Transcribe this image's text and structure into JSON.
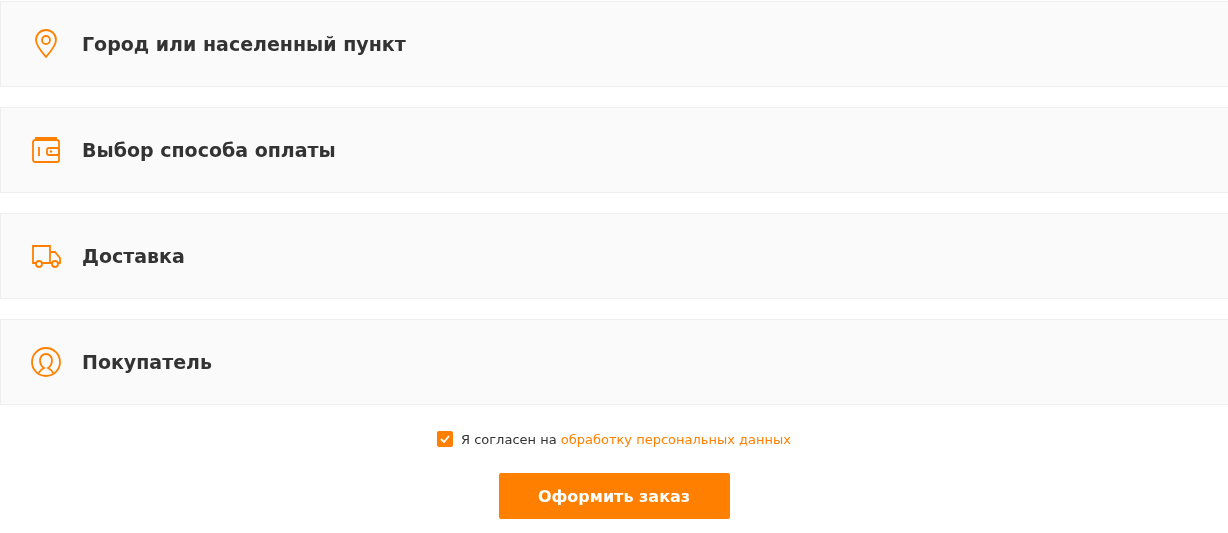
{
  "sections": [
    {
      "kind": "location",
      "title": "Город или населенный пункт"
    },
    {
      "kind": "payment",
      "title": "Выбор способа оплаты"
    },
    {
      "kind": "delivery",
      "title": "Доставка"
    },
    {
      "kind": "buyer",
      "title": "Покупатель"
    }
  ],
  "consent": {
    "checked": true,
    "text": "Я согласен на",
    "link": "обработку персональных данных"
  },
  "submit": "Оформить заказ"
}
